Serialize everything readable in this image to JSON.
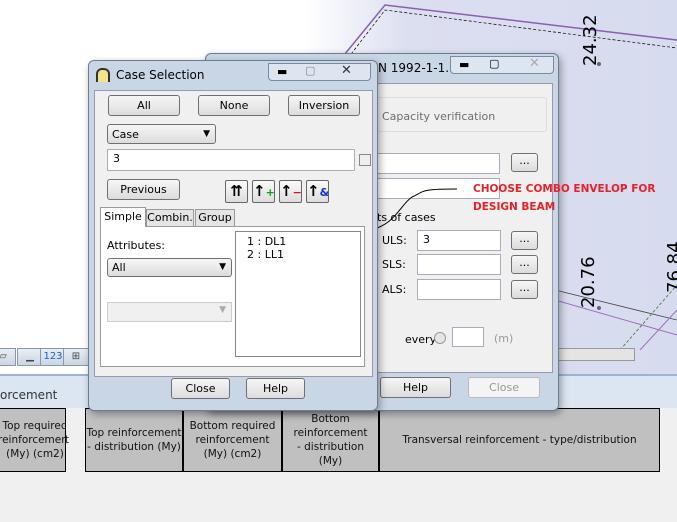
{
  "viewport": {
    "labels": [
      "24.32",
      "20.76",
      "76.84"
    ]
  },
  "panel": {
    "label": "orcement"
  },
  "table": {
    "headers": [
      "Top required reinforcement (My) (cm2)",
      "Top reinforcement - distribution (My)",
      "Bottom required reinforcement (My) (cm2)",
      "Bottom reinforcement - distribution (My)",
      "Transversal reinforcement - type/distribution"
    ]
  },
  "back_dialog": {
    "title": "N 1992-1-1...",
    "capacity": "Capacity verification",
    "lists_label": "ts of cases",
    "uls_label": "ULS:",
    "uls_value": "3",
    "sls_label": "SLS:",
    "als_label": "ALS:",
    "every_label": "every",
    "unit": "(m)",
    "browse": "...",
    "help": "Help",
    "close": "Close"
  },
  "annotation": {
    "text1": "CHOOSE COMBO ENVELOP FOR",
    "text2": "DESIGN BEAM",
    "color": "#e8202a"
  },
  "case_dialog": {
    "title": "Case Selection",
    "all": "All",
    "none": "None",
    "inversion": "Inversion",
    "filter_select": "Case",
    "selection_value": "3",
    "previous": "Previous",
    "tabs": [
      "Simple",
      "Combin.",
      "Group"
    ],
    "attributes_label": "Attributes:",
    "attributes_value": "All",
    "cases": [
      "1 : DL1",
      "2 : LL1"
    ],
    "close": "Close",
    "help": "Help"
  }
}
